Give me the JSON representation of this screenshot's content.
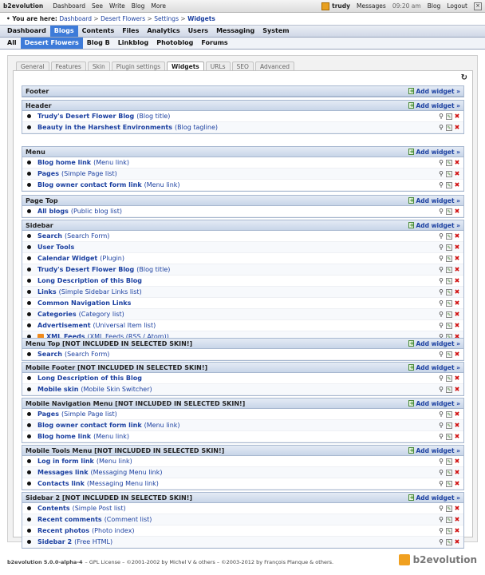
{
  "topbar": {
    "brand": "b2evolution",
    "nav": [
      "Dashboard",
      "See",
      "Write",
      "Blog",
      "More"
    ],
    "user": "trudy",
    "messages": "Messages",
    "time": "09:20 am",
    "blog": "Blog",
    "logout": "Logout"
  },
  "breadcrumb": {
    "prefix": "• You are here:",
    "items": [
      "Dashboard",
      "Desert Flowers",
      "Settings"
    ],
    "current": "Widgets"
  },
  "menu1": [
    "Dashboard",
    "Blogs",
    "Contents",
    "Files",
    "Analytics",
    "Users",
    "Messaging",
    "System"
  ],
  "menu2": [
    "All",
    "Desert Flowers",
    "Blog B",
    "Linkblog",
    "Photoblog",
    "Forums"
  ],
  "tabs": [
    "General",
    "Features",
    "Skin",
    "Plugin settings",
    "Widgets",
    "URLs",
    "SEO",
    "Advanced"
  ],
  "add_widget": "Add widget »",
  "containers": [
    {
      "title": "Footer",
      "widgets": []
    },
    {
      "title": "Header",
      "widgets": [
        {
          "name": "Trudy's Desert Flower Blog",
          "type": "(Blog title)"
        },
        {
          "name": "Beauty in the Harshest Environments",
          "type": "(Blog tagline)"
        }
      ]
    },
    {
      "title": "Menu",
      "widgets": [
        {
          "name": "Blog home link",
          "type": "(Menu link)"
        },
        {
          "name": "Pages",
          "type": "(Simple Page list)"
        },
        {
          "name": "Blog owner contact form link",
          "type": "(Menu link)"
        }
      ]
    },
    {
      "title": "Page Top",
      "widgets": [
        {
          "name": "All blogs",
          "type": "(Public blog list)"
        }
      ]
    },
    {
      "title": "Sidebar",
      "widgets": [
        {
          "name": "Search",
          "type": "(Search Form)"
        },
        {
          "name": "User Tools",
          "type": ""
        },
        {
          "name": "Calendar Widget",
          "type": "(Plugin)"
        },
        {
          "name": "Trudy's Desert Flower Blog",
          "type": "(Blog title)"
        },
        {
          "name": "Long Description of this Blog",
          "type": ""
        },
        {
          "name": "Links",
          "type": "(Simple Sidebar Links list)"
        },
        {
          "name": "Common Navigation Links",
          "type": ""
        },
        {
          "name": "Categories",
          "type": "(Category list)"
        },
        {
          "name": "Advertisement",
          "type": "(Universal Item list)"
        },
        {
          "name": "XML Feeds",
          "type": "(XML Feeds (RSS / Atom))",
          "rss": true
        }
      ]
    },
    {
      "title": "Menu Top [NOT INCLUDED IN SELECTED SKIN!]",
      "widgets": [
        {
          "name": "Search",
          "type": "(Search Form)"
        }
      ]
    },
    {
      "title": "Mobile Footer [NOT INCLUDED IN SELECTED SKIN!]",
      "widgets": [
        {
          "name": "Long Description of this Blog",
          "type": ""
        },
        {
          "name": "Mobile skin",
          "type": "(Mobile Skin Switcher)"
        }
      ]
    },
    {
      "title": "Mobile Navigation Menu [NOT INCLUDED IN SELECTED SKIN!]",
      "widgets": [
        {
          "name": "Pages",
          "type": "(Simple Page list)"
        },
        {
          "name": "Blog owner contact form link",
          "type": "(Menu link)"
        },
        {
          "name": "Blog home link",
          "type": "(Menu link)"
        }
      ]
    },
    {
      "title": "Mobile Tools Menu [NOT INCLUDED IN SELECTED SKIN!]",
      "widgets": [
        {
          "name": "Log in form link",
          "type": "(Menu link)"
        },
        {
          "name": "Messages link",
          "type": "(Messaging Menu link)"
        },
        {
          "name": "Contacts link",
          "type": "(Messaging Menu link)"
        }
      ]
    },
    {
      "title": "Sidebar 2 [NOT INCLUDED IN SELECTED SKIN!]",
      "widgets": [
        {
          "name": "Contents",
          "type": "(Simple Post list)"
        },
        {
          "name": "Recent comments",
          "type": "(Comment list)"
        },
        {
          "name": "Recent photos",
          "type": "(Photo index)"
        },
        {
          "name": "Sidebar 2",
          "type": "(Free HTML)"
        }
      ]
    }
  ],
  "footer": {
    "version": "b2evolution 5.0.0-alpha-4",
    "license": "– GPL License – ©2001-2002 by Michel V & others – ©2003-2012 by François Planque & others.",
    "logo": "b2evolution"
  }
}
